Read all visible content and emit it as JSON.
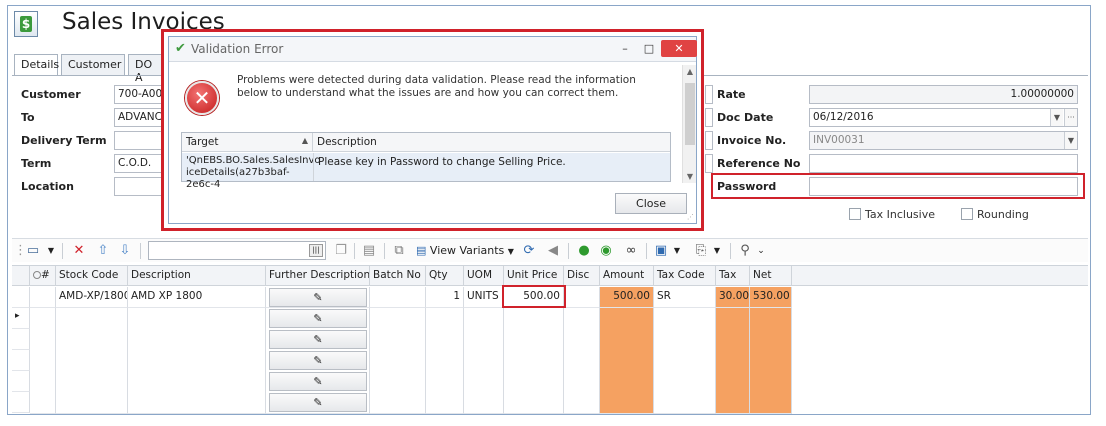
{
  "window": {
    "title": "Sales Invoices"
  },
  "tabs": [
    "Details",
    "Customer",
    "DO A"
  ],
  "form": {
    "customer": {
      "label": "Customer",
      "value": "700-A001"
    },
    "to": {
      "label": "To",
      "value": "ADVANCE"
    },
    "delivery_term": {
      "label": "Delivery Term",
      "value": ""
    },
    "term": {
      "label": "Term",
      "value": "C.O.D."
    },
    "location": {
      "label": "Location",
      "value": ""
    },
    "rate": {
      "label": "Rate",
      "value": "1.00000000"
    },
    "doc_date": {
      "label": "Doc Date",
      "value": "06/12/2016"
    },
    "invoice_no": {
      "label": "Invoice No.",
      "value": "INV00031"
    },
    "reference_no": {
      "label": "Reference No",
      "value": ""
    },
    "password": {
      "label": "Password",
      "value": ""
    },
    "tax_inclusive": {
      "label": "Tax Inclusive",
      "checked": false
    },
    "rounding": {
      "label": "Rounding",
      "checked": false
    }
  },
  "toolbar": {
    "view_variants": "View Variants",
    "icons": [
      "new-doc-icon",
      "delete-icon",
      "move-up-icon",
      "move-down-icon",
      "tag-icon",
      "scan-icon",
      "copy-icon",
      "paste-icon",
      "insert-icon",
      "view-variants-icon",
      "refresh-icon",
      "history-icon",
      "circle-green-icon",
      "circle-down-icon",
      "binoculars-icon",
      "save-icon",
      "export-icon",
      "attach-icon"
    ]
  },
  "grid": {
    "columns": [
      "#",
      "Stock Code",
      "Description",
      "Further Description",
      "Batch No",
      "Qty",
      "UOM",
      "Unit Price",
      "Disc",
      "Amount",
      "Tax Code",
      "Tax",
      "Net"
    ],
    "rows": [
      {
        "stock_code": "AMD-XP/1800",
        "description": "AMD XP 1800",
        "batch": "",
        "qty": "1",
        "uom": "UNITS",
        "unit_price": "500.00",
        "disc": "",
        "amount": "500.00",
        "tax_code": "SR",
        "tax": "30.00",
        "net": "530.00"
      }
    ],
    "row_marker": "▸",
    "edit_icon": "✎"
  },
  "dialog": {
    "title": "Validation Error",
    "message": "Problems were detected during data validation. Please read the information below to understand what the issues are and how you can correct them.",
    "table_headers": [
      "Target",
      "Description"
    ],
    "target": "'QnEBS.BO.Sales.SalesInvoiceDetails(a27b3baf-2e6c-4",
    "target_line1": "'QnEBS.BO.Sales.SalesInvo",
    "target_line2": "iceDetails(a27b3baf-2e6c-4",
    "description": "Please key in Password to change Selling Price.",
    "close_label": "Close",
    "min_glyph": "–",
    "max_glyph": "□",
    "close_glyph": "✕"
  },
  "colors": {
    "highlight_red": "#d0222b",
    "orange": "#f5a161",
    "accent_green": "#3c9a3c"
  }
}
